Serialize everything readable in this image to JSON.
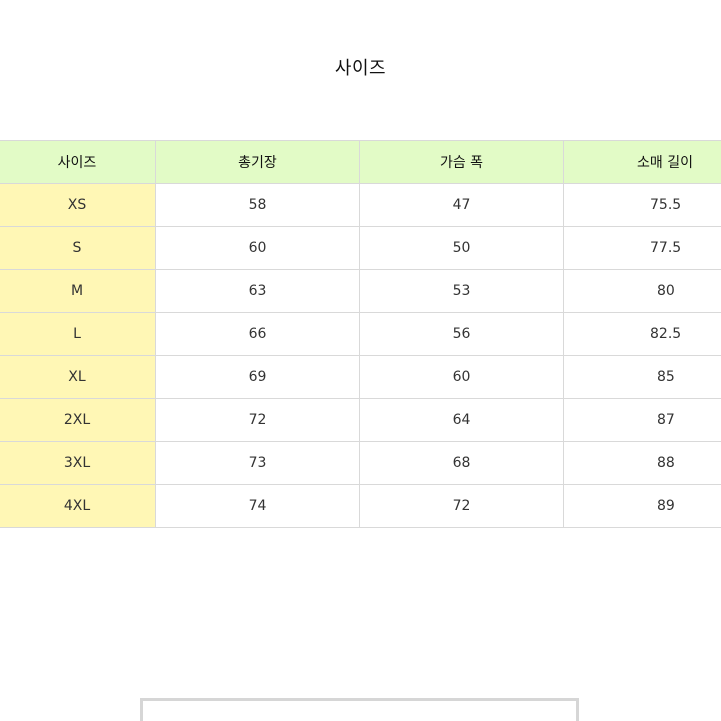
{
  "title": "사이즈",
  "table": {
    "headers": [
      "사이즈",
      "총기장",
      "가슴 폭",
      "소매 길이"
    ],
    "rows": [
      [
        "XS",
        "58",
        "47",
        "75.5"
      ],
      [
        "S",
        "60",
        "50",
        "77.5"
      ],
      [
        "M",
        "63",
        "53",
        "80"
      ],
      [
        "L",
        "66",
        "56",
        "82.5"
      ],
      [
        "XL",
        "69",
        "60",
        "85"
      ],
      [
        "2XL",
        "72",
        "64",
        "87"
      ],
      [
        "3XL",
        "73",
        "68",
        "88"
      ],
      [
        "4XL",
        "74",
        "72",
        "89"
      ]
    ]
  },
  "colors": {
    "header_bg": "#e2fbc6",
    "size_col_bg": "#fff7b5",
    "border": "#d9d9d9"
  }
}
